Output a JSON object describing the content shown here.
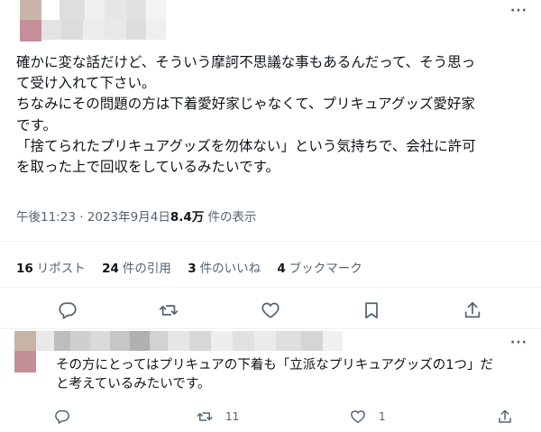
{
  "tweet": {
    "more_icon": "more-horizontal-icon",
    "body_lines": [
      "確かに変な話だけど、そういう摩訶不思議な事もあるんだって、そう思っ",
      "て受け入れて下さい。",
      "ちなみにその問題の方は下着愛好家じゃなくて、プリキュアグッズ愛好家",
      "です。",
      "「捨てられたプリキュアグッズを勿体ない」という気持ちで、会社に許可",
      "を取った上で回収をしているみたいです。"
    ],
    "timestamp": "午後11:23 · 2023年9月4日",
    "view_count": "8.4万",
    "view_label": " 件の表示",
    "stats": [
      {
        "count": "16",
        "label": "リポスト"
      },
      {
        "count": "24",
        "label": "件の引用"
      },
      {
        "count": "3",
        "label": "件のいいね"
      },
      {
        "count": "4",
        "label": "ブックマーク"
      }
    ],
    "actions": [
      "reply-icon",
      "retweet-icon",
      "like-icon",
      "bookmark-icon",
      "share-icon"
    ]
  },
  "reply": {
    "more_icon": "more-horizontal-icon",
    "body_lines": [
      "その方にとってはプリキュアの下着も「立派なプリキュアグッズの1つ」だ",
      "と考えているみたいです。"
    ],
    "retweet_count": "11",
    "like_count": "1"
  },
  "colors": {
    "text": "#0f1419",
    "secondary": "#536471",
    "divider": "#eff3f4"
  }
}
